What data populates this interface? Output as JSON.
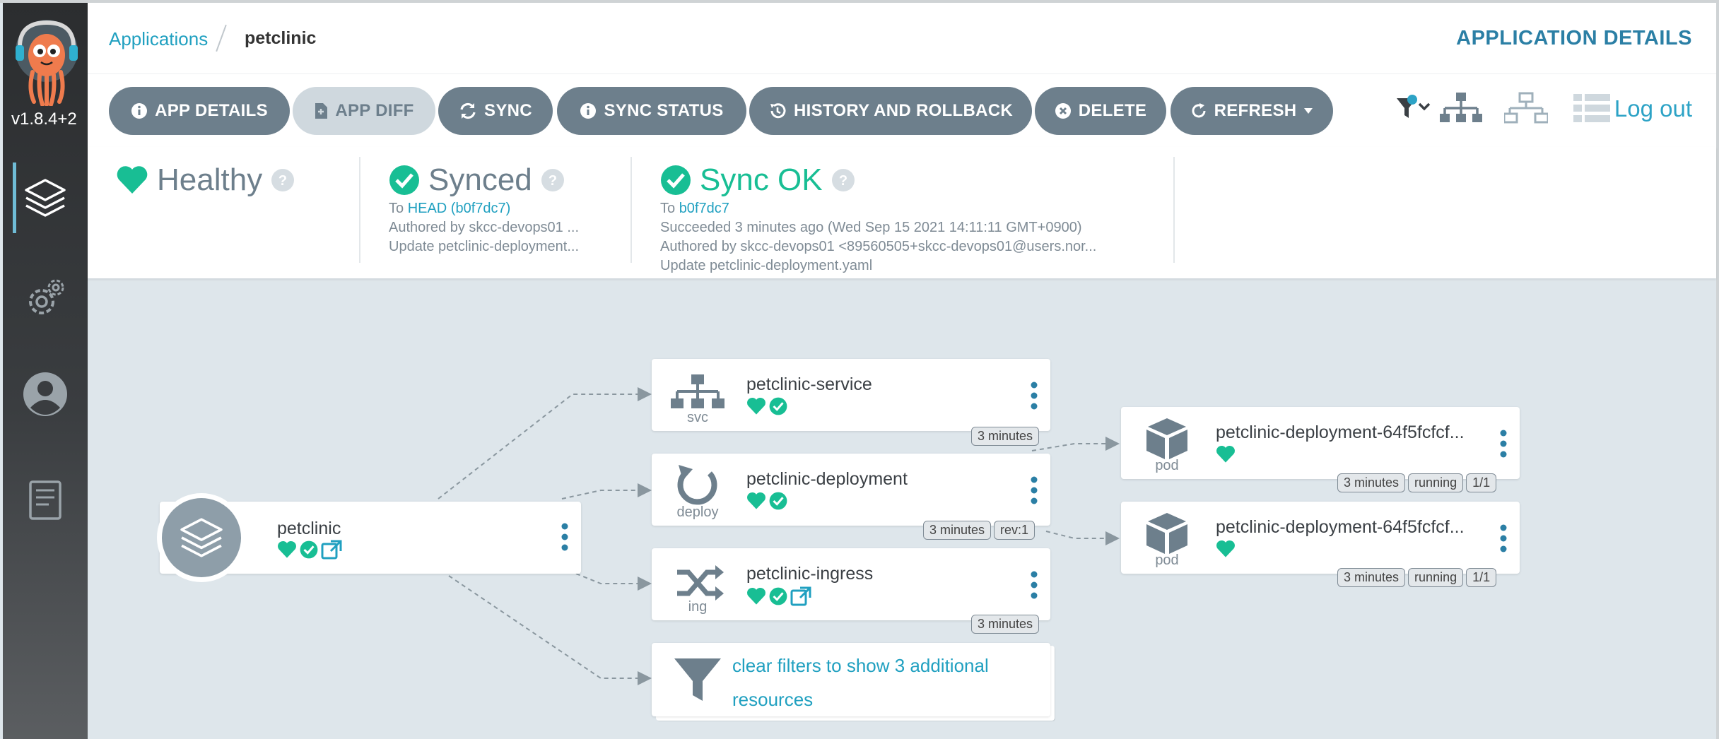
{
  "app": {
    "version": "v1.8.4+2"
  },
  "breadcrumb": {
    "applications": "Applications",
    "current": "petclinic"
  },
  "header": {
    "page_title": "APPLICATION DETAILS"
  },
  "toolbar": {
    "app_details": "APP DETAILS",
    "app_diff": "APP DIFF",
    "sync": "SYNC",
    "sync_status": "SYNC STATUS",
    "history": "HISTORY AND ROLLBACK",
    "delete": "DELETE",
    "refresh": "REFRESH",
    "logout": "Log out"
  },
  "status": {
    "health": {
      "title": "Healthy"
    },
    "sync": {
      "title": "Synced",
      "to_prefix": "To",
      "revision": "HEAD (b0f7dc7)",
      "author": "Authored by skcc-devops01 ...",
      "message": "Update petclinic-deployment..."
    },
    "operation": {
      "title": "Sync OK",
      "to_prefix": "To",
      "revision": "b0f7dc7",
      "succeeded": "Succeeded 3 minutes ago (Wed Sep 15 2021 14:11:11 GMT+0900)",
      "author": "Authored by skcc-devops01 <89560505+skcc-devops01@users.nor...",
      "message": "Update petclinic-deployment.yaml"
    }
  },
  "graph": {
    "app_node": {
      "name": "petclinic"
    },
    "service": {
      "name": "petclinic-service",
      "kind": "svc",
      "age": "3 minutes"
    },
    "deployment": {
      "name": "petclinic-deployment",
      "kind": "deploy",
      "age": "3 minutes",
      "rev": "rev:1"
    },
    "ingress": {
      "name": "petclinic-ingress",
      "kind": "ing",
      "age": "3 minutes"
    },
    "filter": {
      "line1": "clear filters to show 3 additional",
      "line2": "resources"
    },
    "pods": [
      {
        "name": "petclinic-deployment-64f5fcfcf...",
        "kind": "pod",
        "age": "3 minutes",
        "phase": "running",
        "ready": "1/1"
      },
      {
        "name": "petclinic-deployment-64f5fcfcf...",
        "kind": "pod",
        "age": "3 minutes",
        "phase": "running",
        "ready": "1/1"
      }
    ]
  },
  "colors": {
    "accent": "#20a0c0",
    "healthy": "#18be94",
    "button": "#6d7f8c",
    "sidebar": "#2b2d2f",
    "canvas": "#dee6eb"
  }
}
